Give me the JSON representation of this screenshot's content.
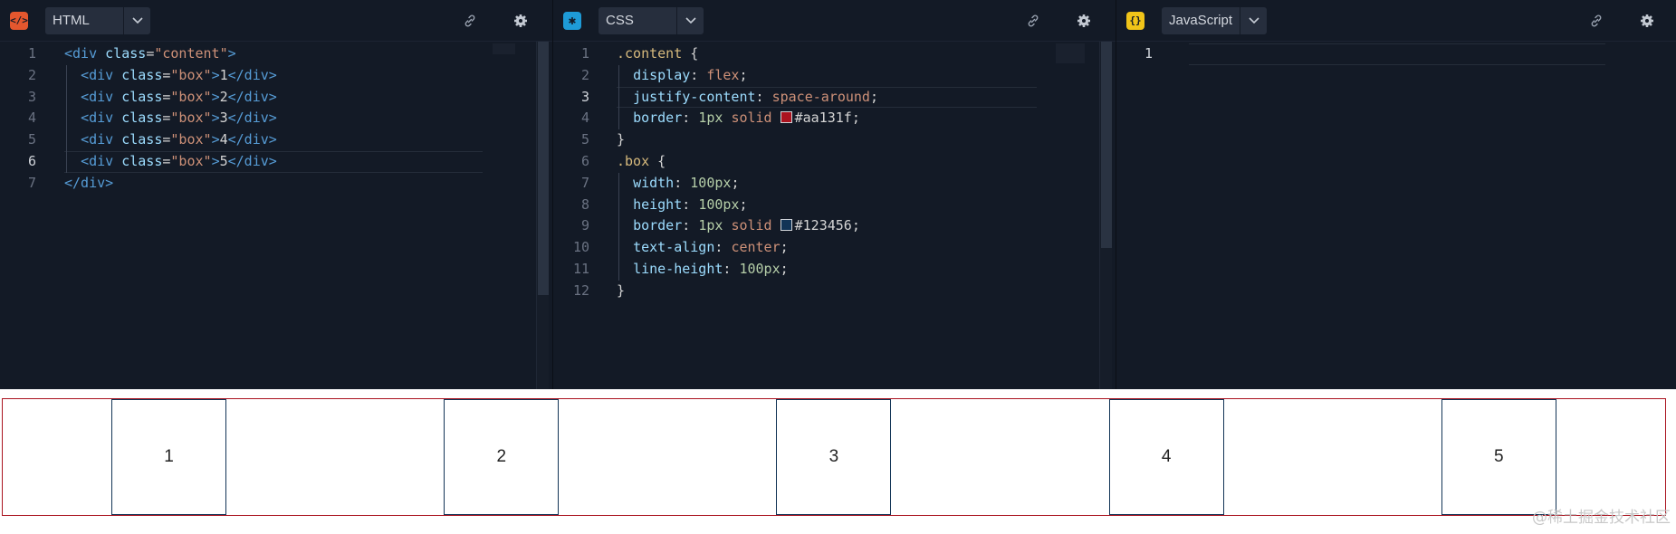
{
  "panes": {
    "html": {
      "lang_label": "HTML",
      "icon": "html-code-icon",
      "icon_text": "</>",
      "icon_color": "#e4572e",
      "lines": [
        {
          "n": "1",
          "tokens": [
            [
              "t-tag",
              "<div "
            ],
            [
              "t-attr",
              "class"
            ],
            [
              "t-plain",
              "="
            ],
            [
              "t-str",
              "\"content\""
            ],
            [
              "t-tag",
              ">"
            ]
          ]
        },
        {
          "n": "2",
          "tokens": [
            [
              "t-plain",
              "  "
            ],
            [
              "t-tag",
              "<div "
            ],
            [
              "t-attr",
              "class"
            ],
            [
              "t-plain",
              "="
            ],
            [
              "t-str",
              "\"box\""
            ],
            [
              "t-tag",
              ">"
            ],
            [
              "t-plain",
              "1"
            ],
            [
              "t-tag",
              "</div>"
            ]
          ]
        },
        {
          "n": "3",
          "tokens": [
            [
              "t-plain",
              "  "
            ],
            [
              "t-tag",
              "<div "
            ],
            [
              "t-attr",
              "class"
            ],
            [
              "t-plain",
              "="
            ],
            [
              "t-str",
              "\"box\""
            ],
            [
              "t-tag",
              ">"
            ],
            [
              "t-plain",
              "2"
            ],
            [
              "t-tag",
              "</div>"
            ]
          ]
        },
        {
          "n": "4",
          "tokens": [
            [
              "t-plain",
              "  "
            ],
            [
              "t-tag",
              "<div "
            ],
            [
              "t-attr",
              "class"
            ],
            [
              "t-plain",
              "="
            ],
            [
              "t-str",
              "\"box\""
            ],
            [
              "t-tag",
              ">"
            ],
            [
              "t-plain",
              "3"
            ],
            [
              "t-tag",
              "</div>"
            ]
          ]
        },
        {
          "n": "5",
          "tokens": [
            [
              "t-plain",
              "  "
            ],
            [
              "t-tag",
              "<div "
            ],
            [
              "t-attr",
              "class"
            ],
            [
              "t-plain",
              "="
            ],
            [
              "t-str",
              "\"box\""
            ],
            [
              "t-tag",
              ">"
            ],
            [
              "t-plain",
              "4"
            ],
            [
              "t-tag",
              "</div>"
            ]
          ]
        },
        {
          "n": "6",
          "tokens": [
            [
              "t-plain",
              "  "
            ],
            [
              "t-tag",
              "<div "
            ],
            [
              "t-attr",
              "class"
            ],
            [
              "t-plain",
              "="
            ],
            [
              "t-str",
              "\"box\""
            ],
            [
              "t-tag",
              ">"
            ],
            [
              "t-plain",
              "5"
            ],
            [
              "t-tag",
              "</div>"
            ]
          ]
        },
        {
          "n": "7",
          "tokens": [
            [
              "t-tag",
              "</div>"
            ]
          ]
        }
      ],
      "active_line": "6"
    },
    "css": {
      "lang_label": "CSS",
      "icon": "css-asterisk-icon",
      "icon_text": "✱",
      "icon_color": "#1e9bd7",
      "lines": [
        {
          "n": "1",
          "tokens": [
            [
              "t-sel",
              ".content"
            ],
            [
              "t-punc",
              " {"
            ]
          ]
        },
        {
          "n": "2",
          "tokens": [
            [
              "t-plain",
              "  "
            ],
            [
              "t-prop",
              "display"
            ],
            [
              "t-punc",
              ": "
            ],
            [
              "t-val",
              "flex"
            ],
            [
              "t-punc",
              ";"
            ]
          ]
        },
        {
          "n": "3",
          "tokens": [
            [
              "t-plain",
              "  "
            ],
            [
              "t-prop",
              "justify-content"
            ],
            [
              "t-punc",
              ": "
            ],
            [
              "t-val",
              "space-around"
            ],
            [
              "t-punc",
              ";"
            ]
          ]
        },
        {
          "n": "4",
          "tokens": [
            [
              "t-plain",
              "  "
            ],
            [
              "t-prop",
              "border"
            ],
            [
              "t-punc",
              ": "
            ],
            [
              "t-num",
              "1px"
            ],
            [
              "t-plain",
              " "
            ],
            [
              "t-val",
              "solid"
            ],
            [
              "t-plain",
              " "
            ],
            [
              "swatch",
              "#aa131f"
            ],
            [
              "t-plain",
              "#aa131f"
            ],
            [
              "t-punc",
              ";"
            ]
          ]
        },
        {
          "n": "5",
          "tokens": [
            [
              "t-punc",
              "}"
            ]
          ]
        },
        {
          "n": "6",
          "tokens": [
            [
              "t-sel",
              ".box"
            ],
            [
              "t-punc",
              " {"
            ]
          ]
        },
        {
          "n": "7",
          "tokens": [
            [
              "t-plain",
              "  "
            ],
            [
              "t-prop",
              "width"
            ],
            [
              "t-punc",
              ": "
            ],
            [
              "t-num",
              "100px"
            ],
            [
              "t-punc",
              ";"
            ]
          ]
        },
        {
          "n": "8",
          "tokens": [
            [
              "t-plain",
              "  "
            ],
            [
              "t-prop",
              "height"
            ],
            [
              "t-punc",
              ": "
            ],
            [
              "t-num",
              "100px"
            ],
            [
              "t-punc",
              ";"
            ]
          ]
        },
        {
          "n": "9",
          "tokens": [
            [
              "t-plain",
              "  "
            ],
            [
              "t-prop",
              "border"
            ],
            [
              "t-punc",
              ": "
            ],
            [
              "t-num",
              "1px"
            ],
            [
              "t-plain",
              " "
            ],
            [
              "t-val",
              "solid"
            ],
            [
              "t-plain",
              " "
            ],
            [
              "swatch",
              "#123456"
            ],
            [
              "t-plain",
              "#123456"
            ],
            [
              "t-punc",
              ";"
            ]
          ]
        },
        {
          "n": "10",
          "tokens": [
            [
              "t-plain",
              "  "
            ],
            [
              "t-prop",
              "text-align"
            ],
            [
              "t-punc",
              ": "
            ],
            [
              "t-val",
              "center"
            ],
            [
              "t-punc",
              ";"
            ]
          ]
        },
        {
          "n": "11",
          "tokens": [
            [
              "t-plain",
              "  "
            ],
            [
              "t-prop",
              "line-height"
            ],
            [
              "t-punc",
              ": "
            ],
            [
              "t-num",
              "100px"
            ],
            [
              "t-punc",
              ";"
            ]
          ]
        },
        {
          "n": "12",
          "tokens": [
            [
              "t-punc",
              "}"
            ]
          ]
        }
      ],
      "active_line": "3"
    },
    "js": {
      "lang_label": "JavaScript",
      "icon": "js-braces-icon",
      "icon_text": "{}",
      "icon_color": "#f0c419",
      "lines": [
        {
          "n": "1",
          "tokens": []
        }
      ],
      "active_line": "1"
    }
  },
  "preview": {
    "boxes": [
      "1",
      "2",
      "3",
      "4",
      "5"
    ]
  },
  "watermark": "@稀土掘金技术社区"
}
